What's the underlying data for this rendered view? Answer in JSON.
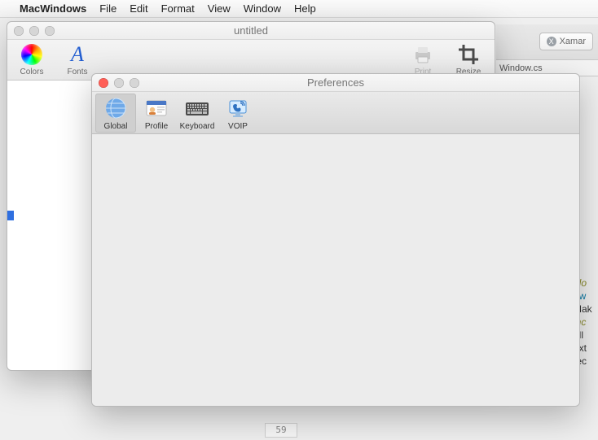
{
  "menubar": {
    "app": "MacWindows",
    "items": [
      "File",
      "Edit",
      "Format",
      "View",
      "Window",
      "Help"
    ]
  },
  "mainWindow": {
    "title": "untitled",
    "toolbar": {
      "colors": "Colors",
      "fonts": "Fonts",
      "print": "Print",
      "resize": "Resize"
    }
  },
  "prefWindow": {
    "title": "Preferences",
    "tabs": {
      "global": "Global",
      "profile": "Profile",
      "keyboard": "Keyboard",
      "voip": "VOIP"
    },
    "selected": "global"
  },
  "ide": {
    "button": "Xamar",
    "tab": "Window.cs",
    "gutter": "59",
    "codeFrag": [
      "olo",
      "ew",
      "Mak",
      "",
      "inc",
      "oll",
      "ext",
      "tec",
      ";"
    ]
  }
}
